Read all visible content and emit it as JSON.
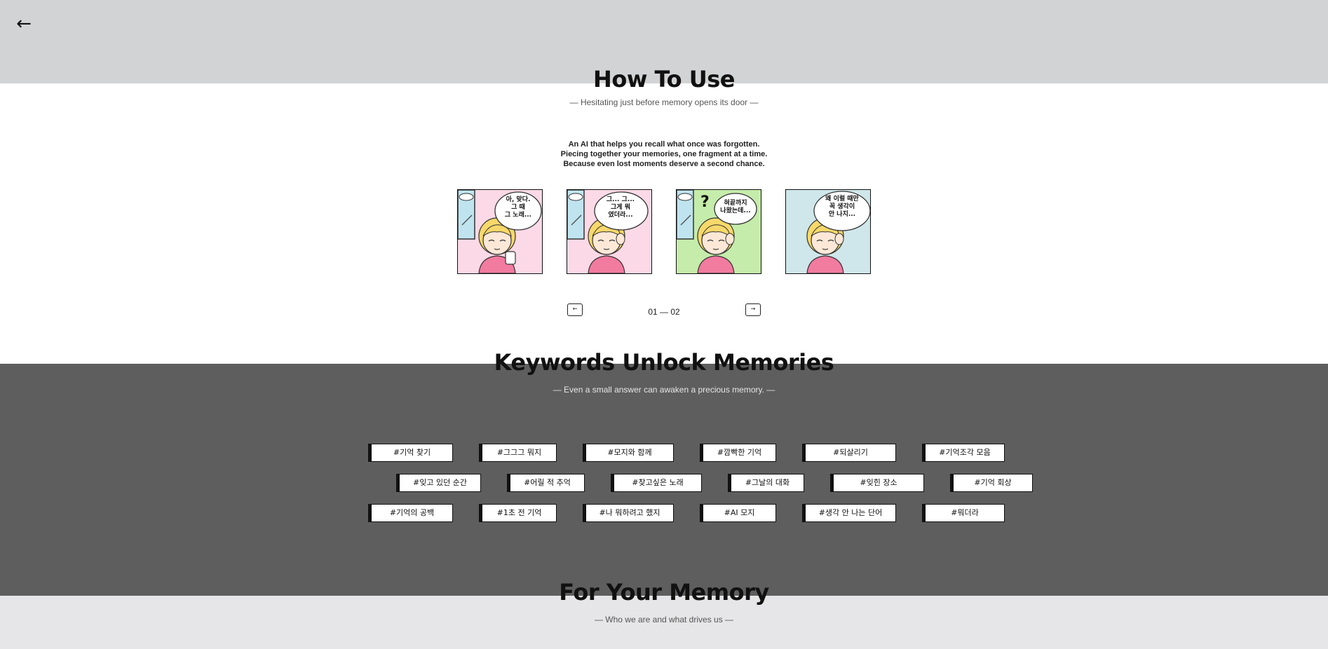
{
  "nav": {
    "back_label": "←"
  },
  "how_to_use": {
    "title": "How To Use",
    "subtitle": "— Hesitating just before memory opens its door —",
    "description": [
      "An AI that helps you recall what once was forgotten.",
      "Piecing together your memories, one fragment at a time.",
      "Because even lost moments deserve a second chance."
    ],
    "panels": [
      {
        "bubble": [
          "아, 맞다.",
          "그 때",
          "그 노래..."
        ],
        "bg": "#fbd9e6"
      },
      {
        "bubble": [
          "그... 그...",
          "그게 뭐",
          "였더라..."
        ],
        "bg": "#fbd9e6"
      },
      {
        "bubble": [
          "혀끝까지",
          "나왔는데..."
        ],
        "bg": "#c5ecaa",
        "mark": "?"
      },
      {
        "bubble": [
          "왜 이럴 때만",
          "꼭 생각이",
          "안 나지..."
        ],
        "bg": "#cfe7ea"
      }
    ],
    "pager": {
      "prev_icon": "←",
      "next_icon": "→",
      "label": "01 — 02"
    }
  },
  "keywords": {
    "title": "Keywords Unlock Memories",
    "subtitle": "— Even a small answer can awaken a precious memory. —",
    "rows": [
      [
        "#기억 찾기",
        "#그그그 뭐지",
        "#모지와 함께",
        "#깜빡한 기억",
        "#되살리기",
        "#기억조각 모음"
      ],
      [
        "#잊고 있던 순간",
        "#어릴 적 추억",
        "#찾고싶은 노래",
        "#그날의 대화",
        "#잊힌 장소",
        "#기억 회상"
      ],
      [
        "#기억의 공백",
        "#1초 전 기억",
        "#나 뭐하려고 했지",
        "#AI 모지",
        "#생각 안 나는 단어",
        "#뭐더라"
      ]
    ]
  },
  "for_your_memory": {
    "title": "For Your Memory",
    "subtitle": "— Who we are and what drives us —"
  },
  "colors": {
    "top_band": "#d2d3d5",
    "dark_band": "#5e5e5e",
    "bottom_band": "#e6e5e7"
  }
}
